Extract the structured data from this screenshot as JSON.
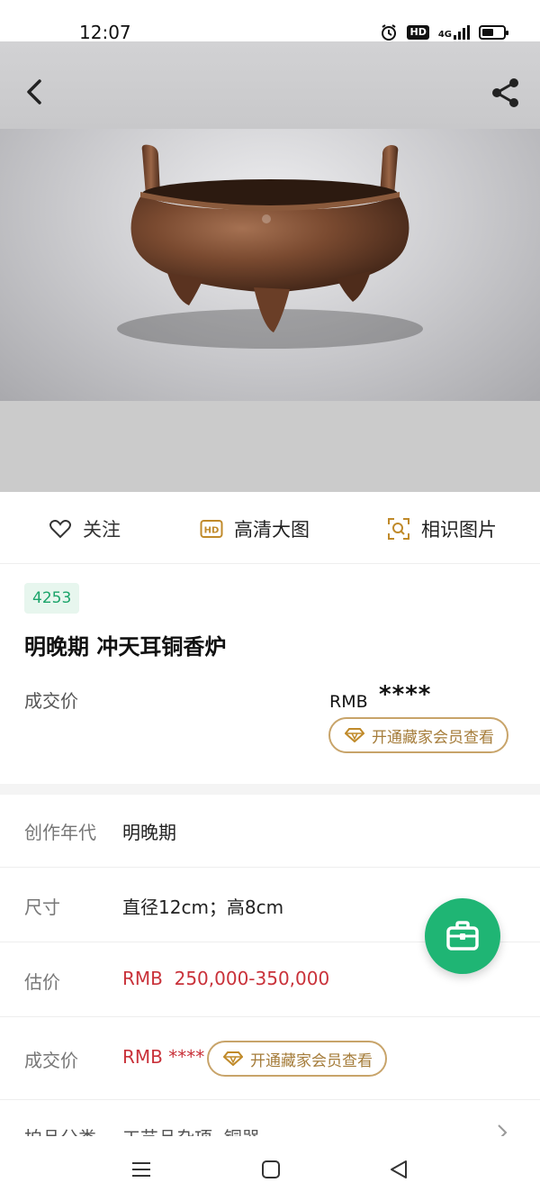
{
  "status_bar": {
    "time": "12:07",
    "hd_badge": "HD",
    "network": "4G",
    "icons": [
      "alarm-icon",
      "hd-icon",
      "signal-icon",
      "battery-icon"
    ]
  },
  "header": {
    "back_icon": "chevron-left-icon",
    "share_icon": "share-icon"
  },
  "actions": {
    "follow_label": "关注",
    "hd_label": "高清大图",
    "hd_icon_text": "HD",
    "similar_label": "相识图片"
  },
  "lot": {
    "number": "4253",
    "title": "明晚期 冲天耳铜香炉"
  },
  "deal_price": {
    "label": "成交价",
    "currency": "RMB",
    "masked": "****",
    "vip_button": "开通藏家会员查看"
  },
  "details": {
    "era_label": "创作年代",
    "era_value": "明晚期",
    "size_label": "尺寸",
    "size_value": "直径12cm；高8cm",
    "estimate_label": "估价",
    "estimate_value": "RMB  250,000-350,000",
    "deal_label": "成交价",
    "deal_value": "RMB ****",
    "deal_vip_button": "开通藏家会员查看",
    "category_label": "拍品分类",
    "category_value": "工艺品杂项  铜器"
  },
  "colors": {
    "accent_green": "#1fb574",
    "price_red": "#c9323a",
    "vip_gold": "#c8a46a",
    "badge_bg": "#e7f6ee"
  }
}
